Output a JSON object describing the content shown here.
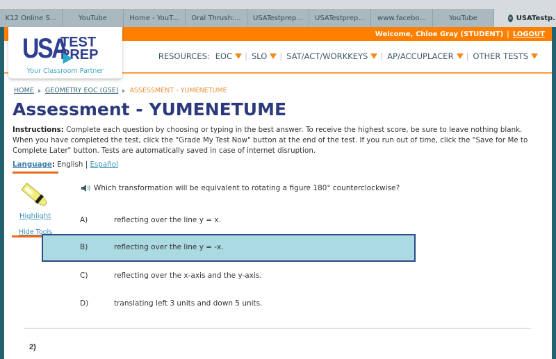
{
  "browser": {
    "tabs": [
      {
        "label": "K12 Online S...",
        "active": false
      },
      {
        "label": "YouTube",
        "active": false
      },
      {
        "label": "Home - YouT...",
        "active": false
      },
      {
        "label": "Oral Thrush:...",
        "active": false
      },
      {
        "label": "USATestprep...",
        "active": false
      },
      {
        "label": "USATestprep...",
        "active": false
      },
      {
        "label": "www.facebo...",
        "active": false
      },
      {
        "label": "YouTube",
        "active": false
      },
      {
        "label": "USATestp...",
        "active": true
      }
    ],
    "close_glyph": "✕"
  },
  "topbar": {
    "welcome": "Welcome, Chloe Gray (STUDENT)",
    "separator": "|",
    "logout": "LOGOUT"
  },
  "logo": {
    "usa": "USA",
    "test": "TEST",
    "prep": "PREP",
    "tagline": "Your Classroom Partner"
  },
  "nav": {
    "label": "RESOURCES:",
    "items": [
      "EOC",
      "SLO",
      "SAT/ACT/WORKKEYS",
      "AP/ACCUPLACER",
      "OTHER TESTS"
    ]
  },
  "breadcrumb": {
    "home": "HOME",
    "course": "GEOMETRY EOC (GSE)",
    "current": "ASSESSMENT - YUMENETUME"
  },
  "page_title": "Assessment - YUMENETUME",
  "instructions": {
    "label": "Instructions:",
    "text": " Complete each question by choosing or typing in the best answer. To receive the highest score, be sure to leave nothing blank. When you have completed the test, click the \"Grade My Test Now\" button at the end of the test. If you run out of time, click the \"Save for Me to Complete Later\" button. Tests are automatically saved in case of internet disruption."
  },
  "language": {
    "label": "Language",
    "colon": ":",
    "current": " English | ",
    "alternate": "Español"
  },
  "tools": {
    "highlight": "Highlight",
    "hide": "Hide Tools"
  },
  "question1": {
    "text": "Which transformation will be equivalent to rotating a figure 180° counterclockwise?",
    "choices": [
      {
        "letter": "A)",
        "text": "reflecting over the line y = x.",
        "selected": false
      },
      {
        "letter": "B)",
        "text": "reflecting over the line y = -x.",
        "selected": true
      },
      {
        "letter": "C)",
        "text": "reflecting over the x-axis and the y-axis.",
        "selected": false
      },
      {
        "letter": "D)",
        "text": "translating left 3 units and down 5 units.",
        "selected": false
      }
    ]
  },
  "question2": {
    "number": "2)"
  },
  "colors": {
    "brand_orange": "#ff7f00",
    "brand_navy": "#2e3f8f",
    "selected_fill": "#abdae3",
    "selected_border": "#2e4b85"
  }
}
